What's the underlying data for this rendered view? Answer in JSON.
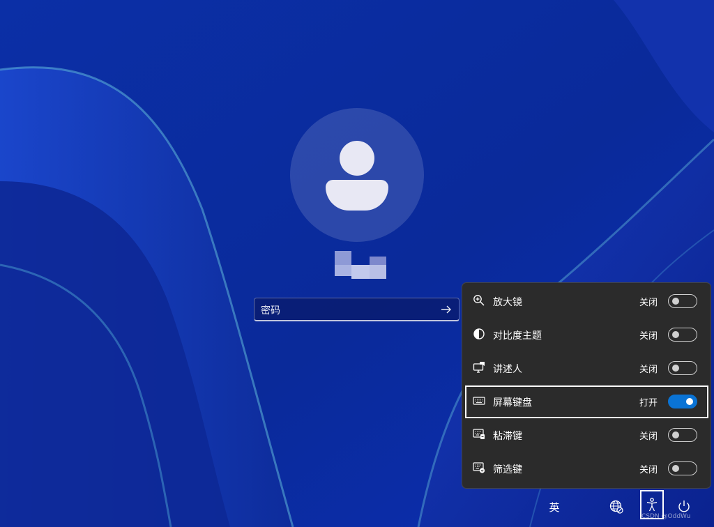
{
  "login": {
    "password_placeholder": "密码"
  },
  "accessibility_menu": {
    "items": [
      {
        "icon": "magnifier-icon",
        "label": "放大镜",
        "state": "关闭",
        "enabled": false
      },
      {
        "icon": "contrast-theme-icon",
        "label": "对比度主题",
        "state": "关闭",
        "enabled": false
      },
      {
        "icon": "narrator-icon",
        "label": "讲述人",
        "state": "关闭",
        "enabled": false
      },
      {
        "icon": "keyboard-icon",
        "label": "屏幕键盘",
        "state": "打开",
        "enabled": true
      },
      {
        "icon": "sticky-keys-icon",
        "label": "粘滞键",
        "state": "关闭",
        "enabled": false
      },
      {
        "icon": "filter-keys-icon",
        "label": "筛选键",
        "state": "关闭",
        "enabled": false
      }
    ]
  },
  "taskbar": {
    "input_language": "英",
    "network_icon": "globe-no-connection-icon",
    "accessibility_icon": "accessibility-icon",
    "power_icon": "power-icon"
  },
  "watermark": "CSDN @OddWu",
  "colors": {
    "toggle_on": "#0a73d4",
    "flyout_bg": "#2b2b2b"
  }
}
